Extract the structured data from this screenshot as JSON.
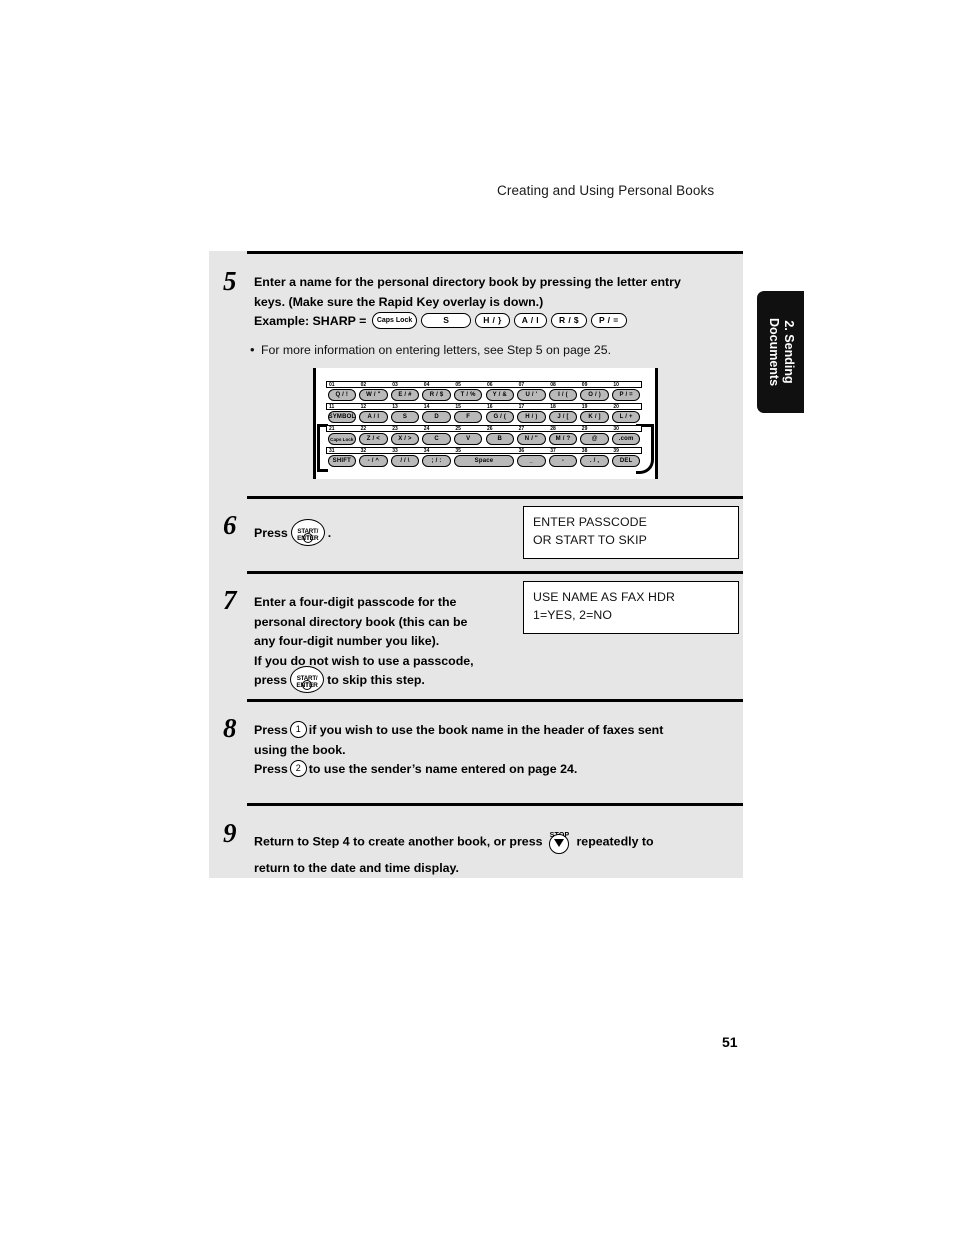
{
  "header": {
    "running_head": "Creating and Using Personal Books"
  },
  "side_tab": {
    "line1": "2. Sending",
    "line2": "Documents"
  },
  "page_number": "51",
  "steps": [
    {
      "number": "5",
      "line1": "Enter a name for the personal directory book by pressing the letter entry",
      "line2": "keys. (Make sure the Rapid Key overlay is down.)",
      "line3_label": "Example: SHARP =",
      "example_keys": [
        "Caps Lock",
        "S",
        "H / }",
        "A / l",
        "R / $",
        "P / ="
      ],
      "bullet": "For more information on entering letters, see Step 5 on page 25."
    },
    {
      "number": "6",
      "press_label": "Press",
      "key": {
        "top": "START/",
        "bottom": "ENTER",
        "icon": "power-icon"
      },
      "trailing": ".",
      "lcd": {
        "line1": "ENTER PASSCODE",
        "line2": "OR START TO SKIP"
      }
    },
    {
      "number": "7",
      "line1": "Enter a four-digit passcode for the",
      "line2": "personal directory book (this can be",
      "line3": "any four-digit number you like).",
      "line4": "If you do not wish to use a passcode,",
      "line5_pre": "press",
      "line5_post": "to skip this step.",
      "key": {
        "top": "START/",
        "bottom": "ENTER",
        "icon": "power-icon"
      },
      "lcd": {
        "line1": "USE NAME AS FAX HDR",
        "line2": "1=YES, 2=NO"
      }
    },
    {
      "number": "8",
      "l1_pre": "Press",
      "l1_key": "1",
      "l1_post": "if you wish to use the book name in the header of faxes sent",
      "l2": "using the book.",
      "l3_pre": "Press",
      "l3_key": "2",
      "l3_post": "to use the sender’s name entered on page 24."
    },
    {
      "number": "9",
      "l1_pre": "Return to Step 4 to create another book, or press",
      "stop_label": "STOP",
      "l1_post": "repeatedly to",
      "l2": "return to the date and time display."
    }
  ],
  "keyboard": {
    "rows": [
      {
        "numbers": [
          "01",
          "02",
          "03",
          "04",
          "05",
          "06",
          "07",
          "08",
          "09",
          "10"
        ],
        "keys": [
          "Q / !",
          "W / \"",
          "E / #",
          "R / $",
          "T / %",
          "Y / &",
          "U / '",
          "I / (",
          "O / )",
          "P / ="
        ]
      },
      {
        "numbers": [
          "11",
          "12",
          "13",
          "14",
          "15",
          "16",
          "17",
          "18",
          "19",
          "20"
        ],
        "keys": [
          "SYMBOL",
          "A / l",
          "S",
          "D",
          "F",
          "G / (",
          "H / )",
          "J / [",
          "K / ]",
          "L / +"
        ]
      },
      {
        "numbers": [
          "21",
          "22",
          "23",
          "24",
          "25",
          "26",
          "27",
          "28",
          "29",
          "30"
        ],
        "keys": [
          "Caps Lock",
          "Z / <",
          "X / >",
          "C",
          "V",
          "B",
          "N / \"",
          "M / ?",
          "@",
          ".com"
        ]
      },
      {
        "numbers": [
          "31",
          "32",
          "33",
          "34",
          "35",
          "36",
          "37",
          "38",
          "39"
        ],
        "keys": [
          "SHIFT",
          "- / ^",
          "/ / \\",
          "; / :",
          "Space",
          "_",
          "-",
          ". / ,",
          "DEL"
        ]
      }
    ]
  },
  "colors": {
    "panel_bg": "#e6e6e6",
    "key_fill": "#b9b9b9",
    "tab_bg": "#101010",
    "rule": "#000000"
  }
}
